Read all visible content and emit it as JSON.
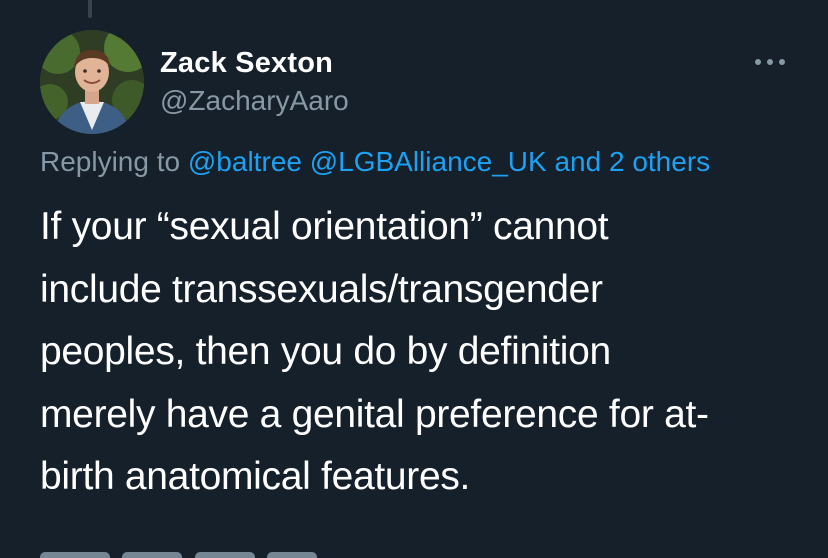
{
  "tweet": {
    "author": {
      "display_name": "Zack Sexton",
      "handle": "@ZacharyAaro"
    },
    "more_icon": "more-horizontal-icon",
    "replying": {
      "prefix": "Replying to",
      "mention_1": "@baltree",
      "mention_2": "@LGBAlliance_UK",
      "others": "and 2 others"
    },
    "text_lines": [
      "If your “sexual orientation” cannot",
      "include transsexuals/transgender",
      "peoples, then you do by definition",
      "merely have a genital preference for at-",
      "birth anatomical features."
    ]
  },
  "colors": {
    "background": "#15202b",
    "text_primary": "#ffffff",
    "text_secondary": "#8899a6",
    "link": "#1da1f2",
    "thread_line": "#38444d"
  }
}
